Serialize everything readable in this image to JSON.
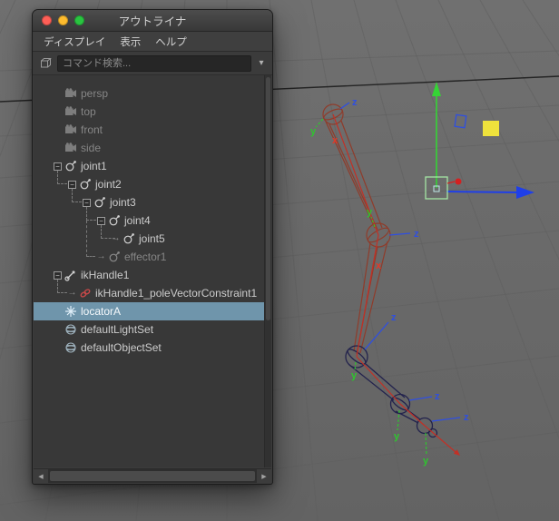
{
  "window": {
    "title": "アウトライナ",
    "menu_items": [
      {
        "label": "ディスプレイ"
      },
      {
        "label": "表示"
      },
      {
        "label": "ヘルプ"
      }
    ],
    "search": {
      "placeholder": "コマンド検索...",
      "caret": "▾"
    },
    "tree": {
      "collapse_glyph": "−",
      "connector_glyph": "→",
      "selected": "locatorA",
      "items": [
        {
          "label": "persp",
          "depth": 0,
          "icon": "camera",
          "muted": true
        },
        {
          "label": "top",
          "depth": 0,
          "icon": "camera",
          "muted": true
        },
        {
          "label": "front",
          "depth": 0,
          "icon": "camera",
          "muted": true
        },
        {
          "label": "side",
          "depth": 0,
          "icon": "camera",
          "muted": true
        },
        {
          "label": "joint1",
          "depth": 0,
          "icon": "joint",
          "expanded": true
        },
        {
          "label": "joint2",
          "depth": 1,
          "icon": "joint",
          "expanded": true
        },
        {
          "label": "joint3",
          "depth": 2,
          "icon": "joint",
          "expanded": true
        },
        {
          "label": "joint4",
          "depth": 3,
          "icon": "joint",
          "expanded": true
        },
        {
          "label": "joint5",
          "depth": 4,
          "icon": "joint"
        },
        {
          "label": "effector1",
          "depth": 3,
          "icon": "effector",
          "muted": true
        },
        {
          "label": "ikHandle1",
          "depth": 0,
          "icon": "ikhandle",
          "expanded": true
        },
        {
          "label": "ikHandle1_poleVectorConstraint1",
          "depth": 1,
          "icon": "constraint"
        },
        {
          "label": "locatorA",
          "depth": 0,
          "icon": "locator",
          "selected": true
        },
        {
          "label": "defaultLightSet",
          "depth": 0,
          "icon": "set"
        },
        {
          "label": "defaultObjectSet",
          "depth": 0,
          "icon": "set"
        }
      ]
    },
    "hscroll": {
      "left_arrow": "◀",
      "right_arrow": "▶"
    }
  },
  "viewport": {
    "axis_labels": [
      {
        "text": "z",
        "axis": "z"
      },
      {
        "text": "y",
        "axis": "y"
      },
      {
        "text": "x",
        "axis": "x"
      },
      {
        "text": "z",
        "axis": "z"
      },
      {
        "text": "y",
        "axis": "y"
      },
      {
        "text": "x",
        "axis": "x"
      },
      {
        "text": "z",
        "axis": "z"
      },
      {
        "text": "y",
        "axis": "y"
      },
      {
        "text": "z",
        "axis": "z"
      },
      {
        "text": "y",
        "axis": "y"
      },
      {
        "text": "z",
        "axis": "z"
      },
      {
        "text": "y",
        "axis": "y"
      }
    ]
  },
  "colors": {
    "viewport_bg": "#6b6b6b",
    "grid_line": "#5e5e5e",
    "grid_axis_line": "#181818",
    "window_bg": "#3b3b3b",
    "selection_highlight": "#6f95ab",
    "bone_upper": "#8f3c2b",
    "bone_lower": "#23234d",
    "ik_line_red": "#c23026",
    "axis_x": "#e03a2a",
    "axis_y": "#2fc42f",
    "axis_z": "#2f4fe0",
    "manipulator_green": "#35d435",
    "manipulator_blue": "#1f3fe8",
    "manipulator_center": "#a5e6a5",
    "marker_yellow": "#efe23c",
    "traffic_close": "#ff5f57",
    "traffic_min": "#febc2e",
    "traffic_zoom": "#29c440"
  }
}
